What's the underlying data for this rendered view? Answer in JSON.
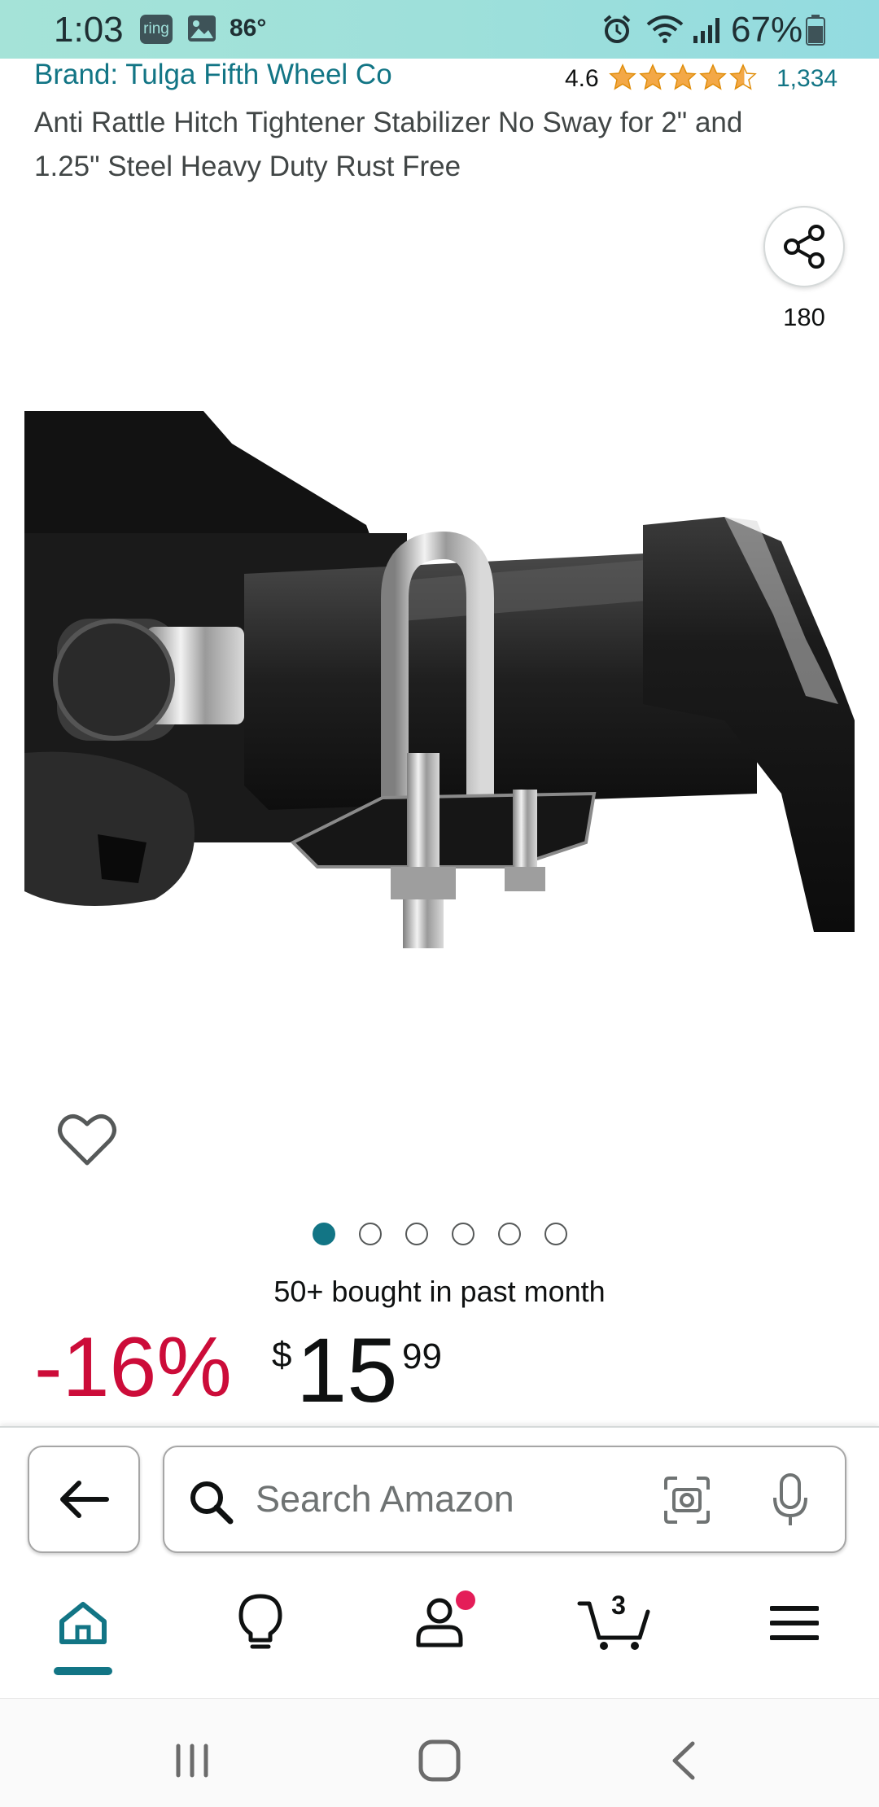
{
  "status_bar": {
    "time": "1:03",
    "ring_label": "ring",
    "temperature": "86°",
    "battery_percent": "67%"
  },
  "product": {
    "brand": "Brand: Tulga Fifth Wheel Co",
    "rating_value": "4.6",
    "rating_stars": 4.5,
    "rating_count": "1,334",
    "title": "Anti Rattle Hitch Tightener Stabilizer No Sway for 2\" and 1.25\" Steel Heavy Duty Rust Free",
    "share_count": "180",
    "image_count": 6,
    "active_image_index": 0,
    "bought_text": "50+ bought in past month",
    "discount": "-16%",
    "price_symbol": "$",
    "price_whole": "15",
    "price_fraction": "99"
  },
  "search": {
    "placeholder": "Search Amazon"
  },
  "bottom_nav": {
    "items": [
      "home-icon",
      "lightbulb-icon",
      "account-icon",
      "cart-icon",
      "menu-icon"
    ],
    "cart_count": "3"
  },
  "colors": {
    "link": "#127585",
    "discount": "#cc0c39",
    "star": "#f3a847",
    "active_dot": "#127585",
    "notification": "#e41d58"
  }
}
